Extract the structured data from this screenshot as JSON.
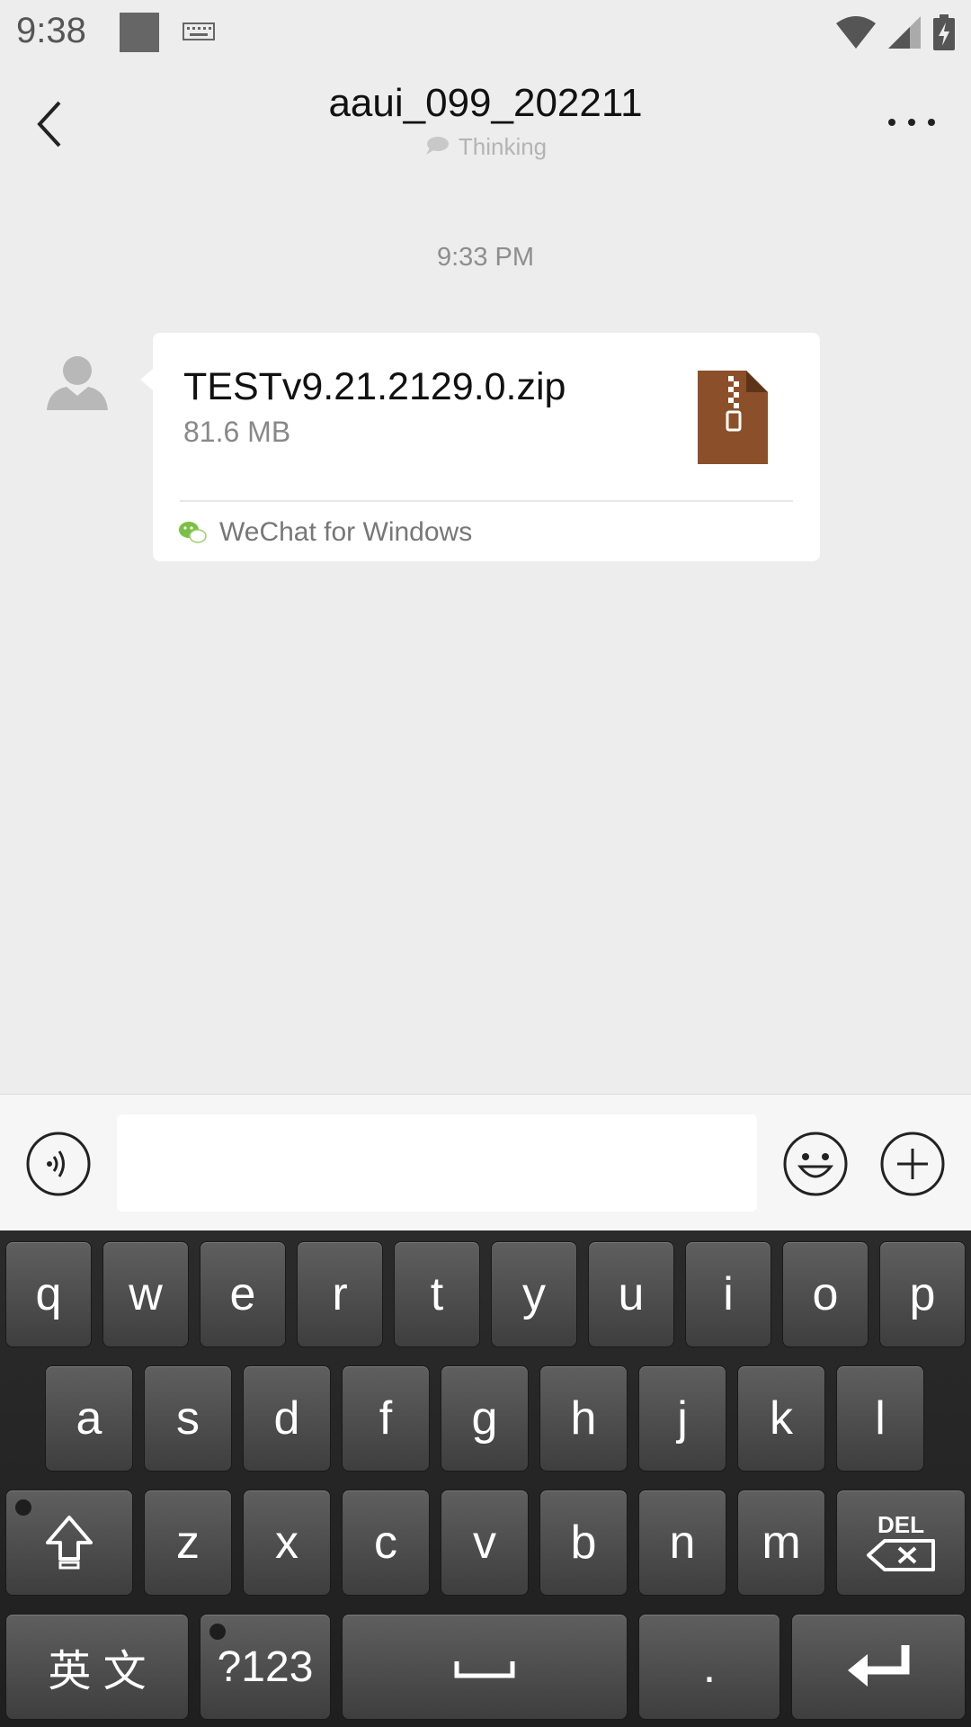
{
  "status": {
    "time": "9:38"
  },
  "header": {
    "title": "aaui_099_202211",
    "subtitle": "Thinking"
  },
  "chat": {
    "timestamp": "9:33 PM",
    "message": {
      "file_name": "TESTv9.21.2129.0.zip",
      "file_size": "81.6 MB",
      "source": "WeChat for Windows"
    }
  },
  "input": {
    "placeholder": ""
  },
  "keyboard": {
    "row1": [
      "q",
      "w",
      "e",
      "r",
      "t",
      "y",
      "u",
      "i",
      "o",
      "p"
    ],
    "row2": [
      "a",
      "s",
      "d",
      "f",
      "g",
      "h",
      "j",
      "k",
      "l"
    ],
    "row3": [
      "z",
      "x",
      "c",
      "v",
      "b",
      "n",
      "m"
    ],
    "lang": "英 文",
    "numbers": "?123",
    "period": ".",
    "del": "DEL"
  },
  "colors": {
    "background": "#ededed",
    "zip_icon": "#8b5029",
    "wechat_green": "#7bc043"
  }
}
